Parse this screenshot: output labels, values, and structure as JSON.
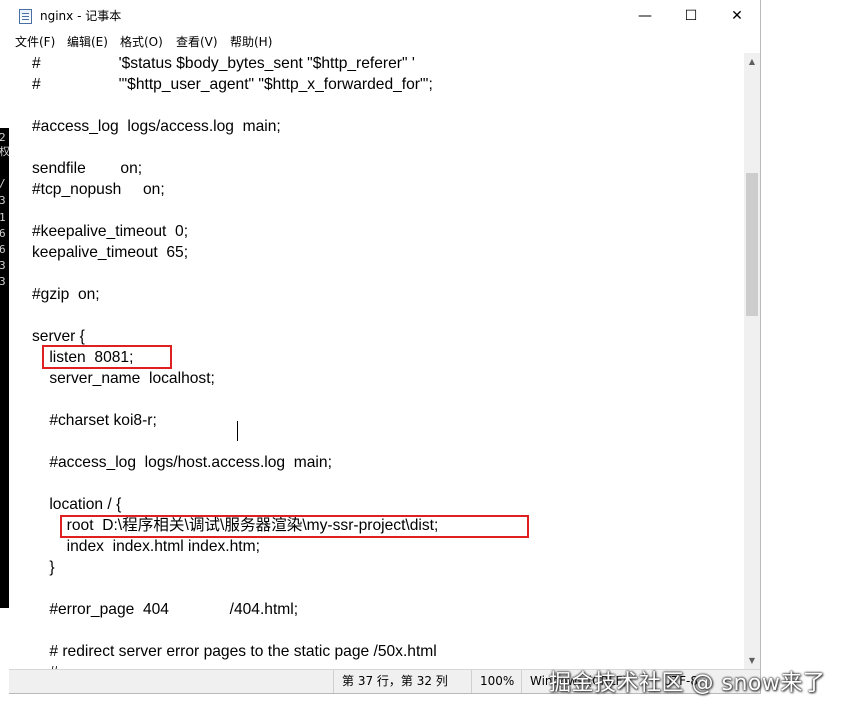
{
  "window": {
    "title": "nginx - 记事本",
    "controls": {
      "minimize": "—",
      "maximize": "☐",
      "close": "✕"
    }
  },
  "menu": [
    {
      "label": "文件(F)"
    },
    {
      "label": "编辑(E)"
    },
    {
      "label": "格式(O)"
    },
    {
      "label": "查看(V)"
    },
    {
      "label": "帮助(H)"
    }
  ],
  "editor": {
    "lines": [
      "#                  '$status $body_bytes_sent \"$http_referer\" '",
      "#                  '\"$http_user_agent\" \"$http_x_forwarded_for\"';",
      "",
      "#access_log  logs/access.log  main;",
      "",
      "sendfile        on;",
      "#tcp_nopush     on;",
      "",
      "#keepalive_timeout  0;",
      "keepalive_timeout  65;",
      "",
      "#gzip  on;",
      "",
      "server {",
      "    listen  8081;",
      "    server_name  localhost;",
      "",
      "    #charset koi8-r;",
      "",
      "    #access_log  logs/host.access.log  main;",
      "",
      "    location / {",
      "        root  D:\\程序相关\\调试\\服务器渲染\\my-ssr-project\\dist;",
      "        index  index.html index.htm;",
      "    }",
      "",
      "    #error_page  404              /404.html;",
      "",
      "    # redirect server error pages to the static page /50x.html",
      "    #"
    ]
  },
  "status": {
    "position": "第 37 行，第 32 列",
    "zoom": "100%",
    "line_ending": "Windows (CRLF)",
    "encoding": "UTF-8"
  },
  "background_terminal": {
    "chars": [
      "2",
      "权",
      "",
      "/",
      "3",
      "1",
      "6",
      "6",
      "3",
      "3"
    ]
  },
  "watermark": "掘金技术社区 @ snow来了",
  "colors": {
    "highlight_border": "#e02020",
    "scroll_thumb": "#cdcdcd",
    "statusbar_bg": "#f0f0f0"
  }
}
